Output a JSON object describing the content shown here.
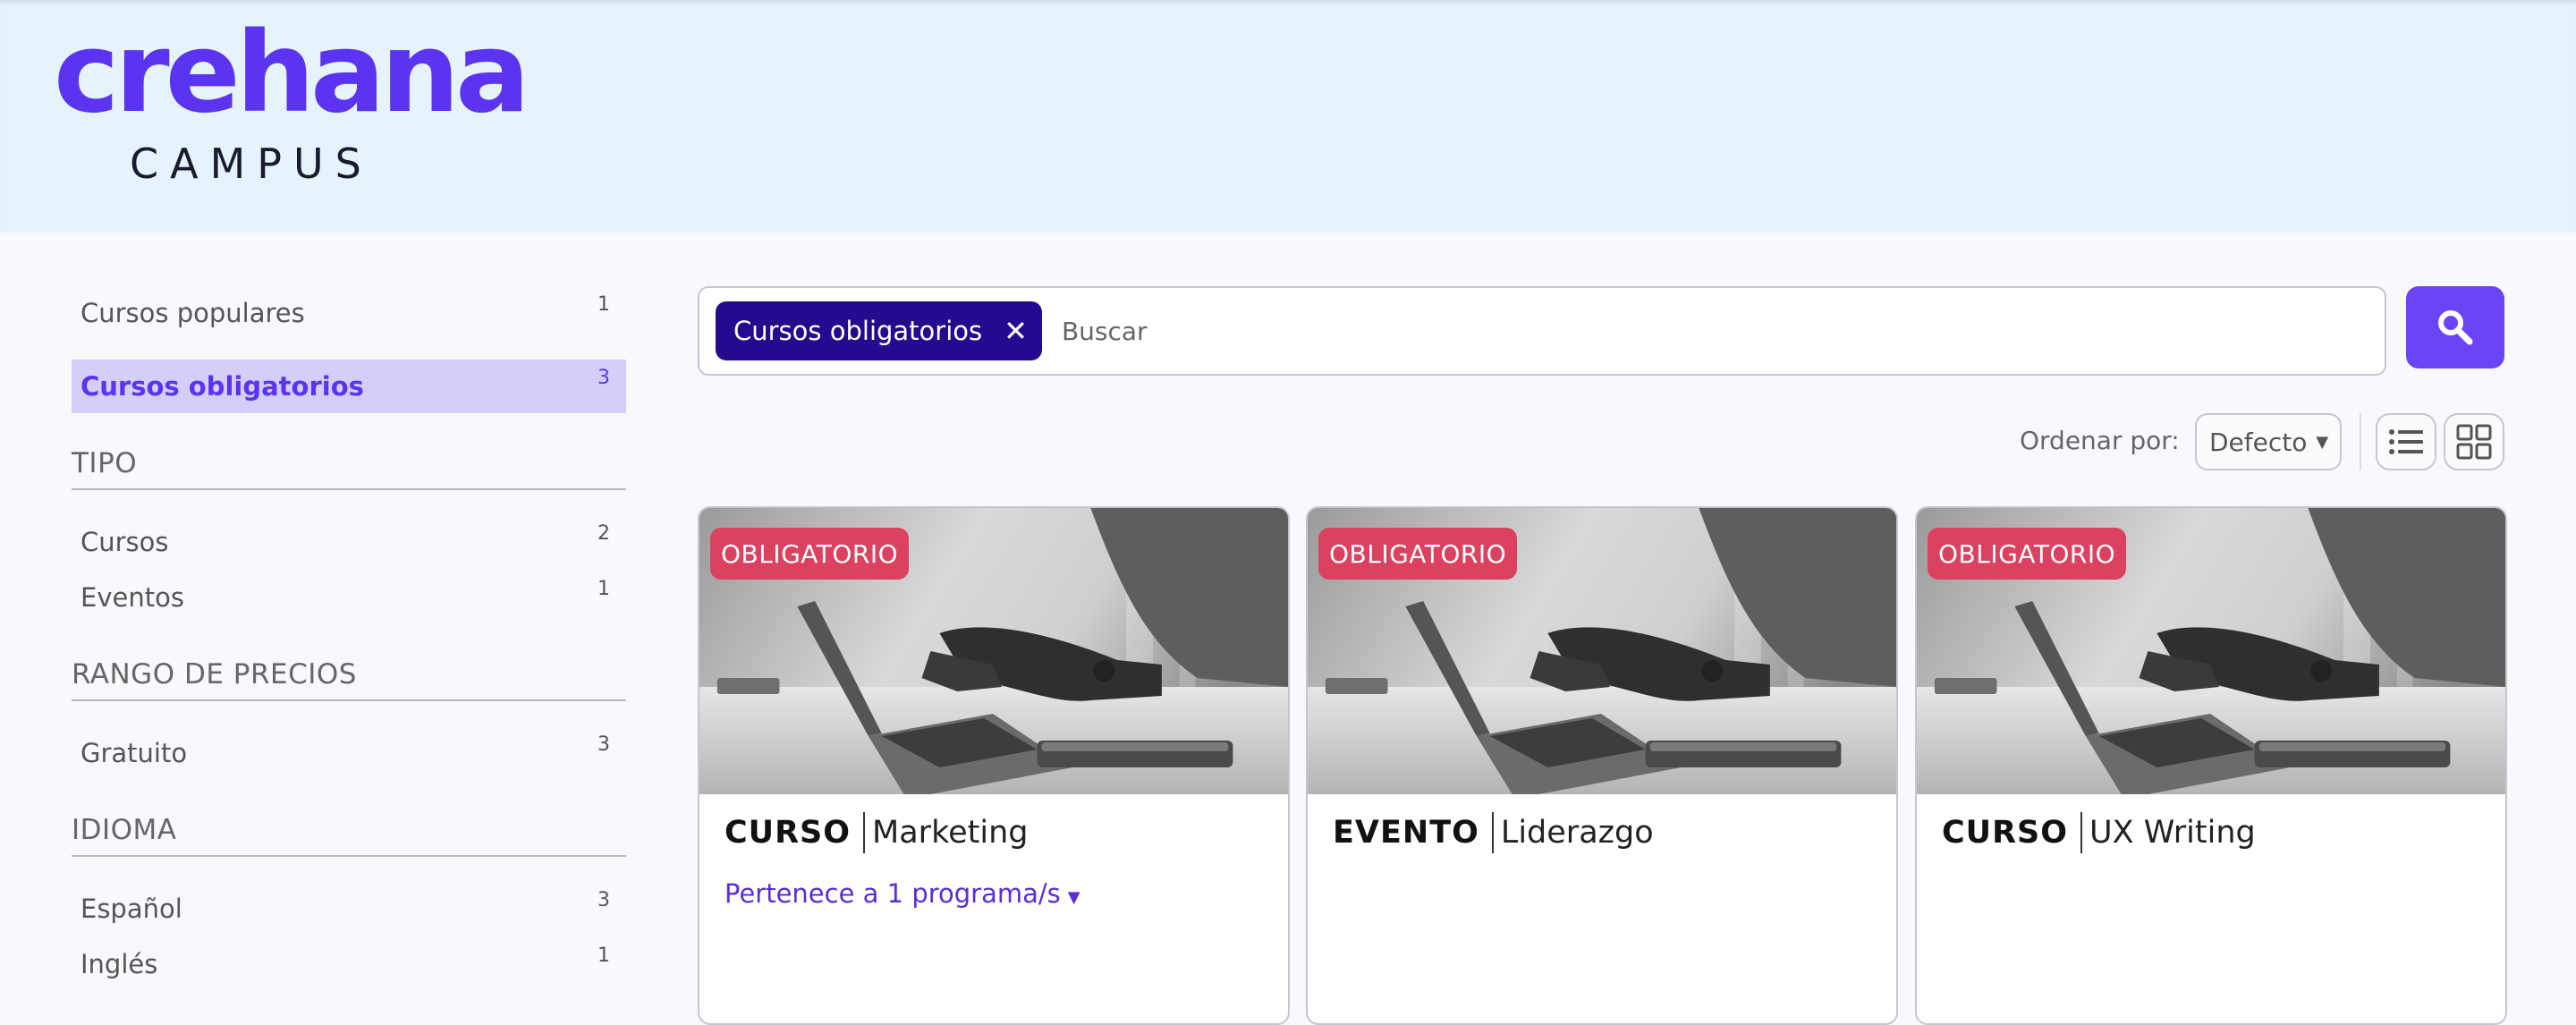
{
  "header": {
    "logo_word": "crehana",
    "logo_sub": "CAMPUS"
  },
  "sidebar": {
    "top_items": [
      {
        "label": "Cursos populares",
        "count": "1"
      },
      {
        "label": "Cursos obligatorios",
        "count": "3"
      }
    ],
    "sections": [
      {
        "title": "TIPO",
        "items": [
          {
            "label": "Cursos",
            "count": "2"
          },
          {
            "label": "Eventos",
            "count": "1"
          }
        ]
      },
      {
        "title": "RANGO DE PRECIOS",
        "items": [
          {
            "label": "Gratuito",
            "count": "3"
          }
        ]
      },
      {
        "title": "IDIOMA",
        "items": [
          {
            "label": "Español",
            "count": "3"
          },
          {
            "label": "Inglés",
            "count": "1"
          }
        ]
      }
    ]
  },
  "search": {
    "chip_label": "Cursos obligatorios",
    "placeholder": "Buscar"
  },
  "sort": {
    "label": "Ordenar por:",
    "value": "Defecto"
  },
  "cards": [
    {
      "badge": "OBLIGATORIO",
      "type": "CURSO",
      "category": "Marketing",
      "link": "Pertenece a 1 programa/s"
    },
    {
      "badge": "OBLIGATORIO",
      "type": "EVENTO",
      "category": "Liderazgo"
    },
    {
      "badge": "OBLIGATORIO",
      "type": "CURSO",
      "category": "UX Writing"
    }
  ],
  "colors": {
    "brand": "#5a34f0",
    "chip": "#240a8e",
    "badge": "#dc4160",
    "header_bg": "#e6f3fd",
    "active_filter_bg": "#d4cefa"
  },
  "icons": {
    "search_button": "search-icon",
    "chip_remove": "close-icon",
    "list_view": "list-view-icon",
    "grid_view": "grid-view-icon"
  }
}
